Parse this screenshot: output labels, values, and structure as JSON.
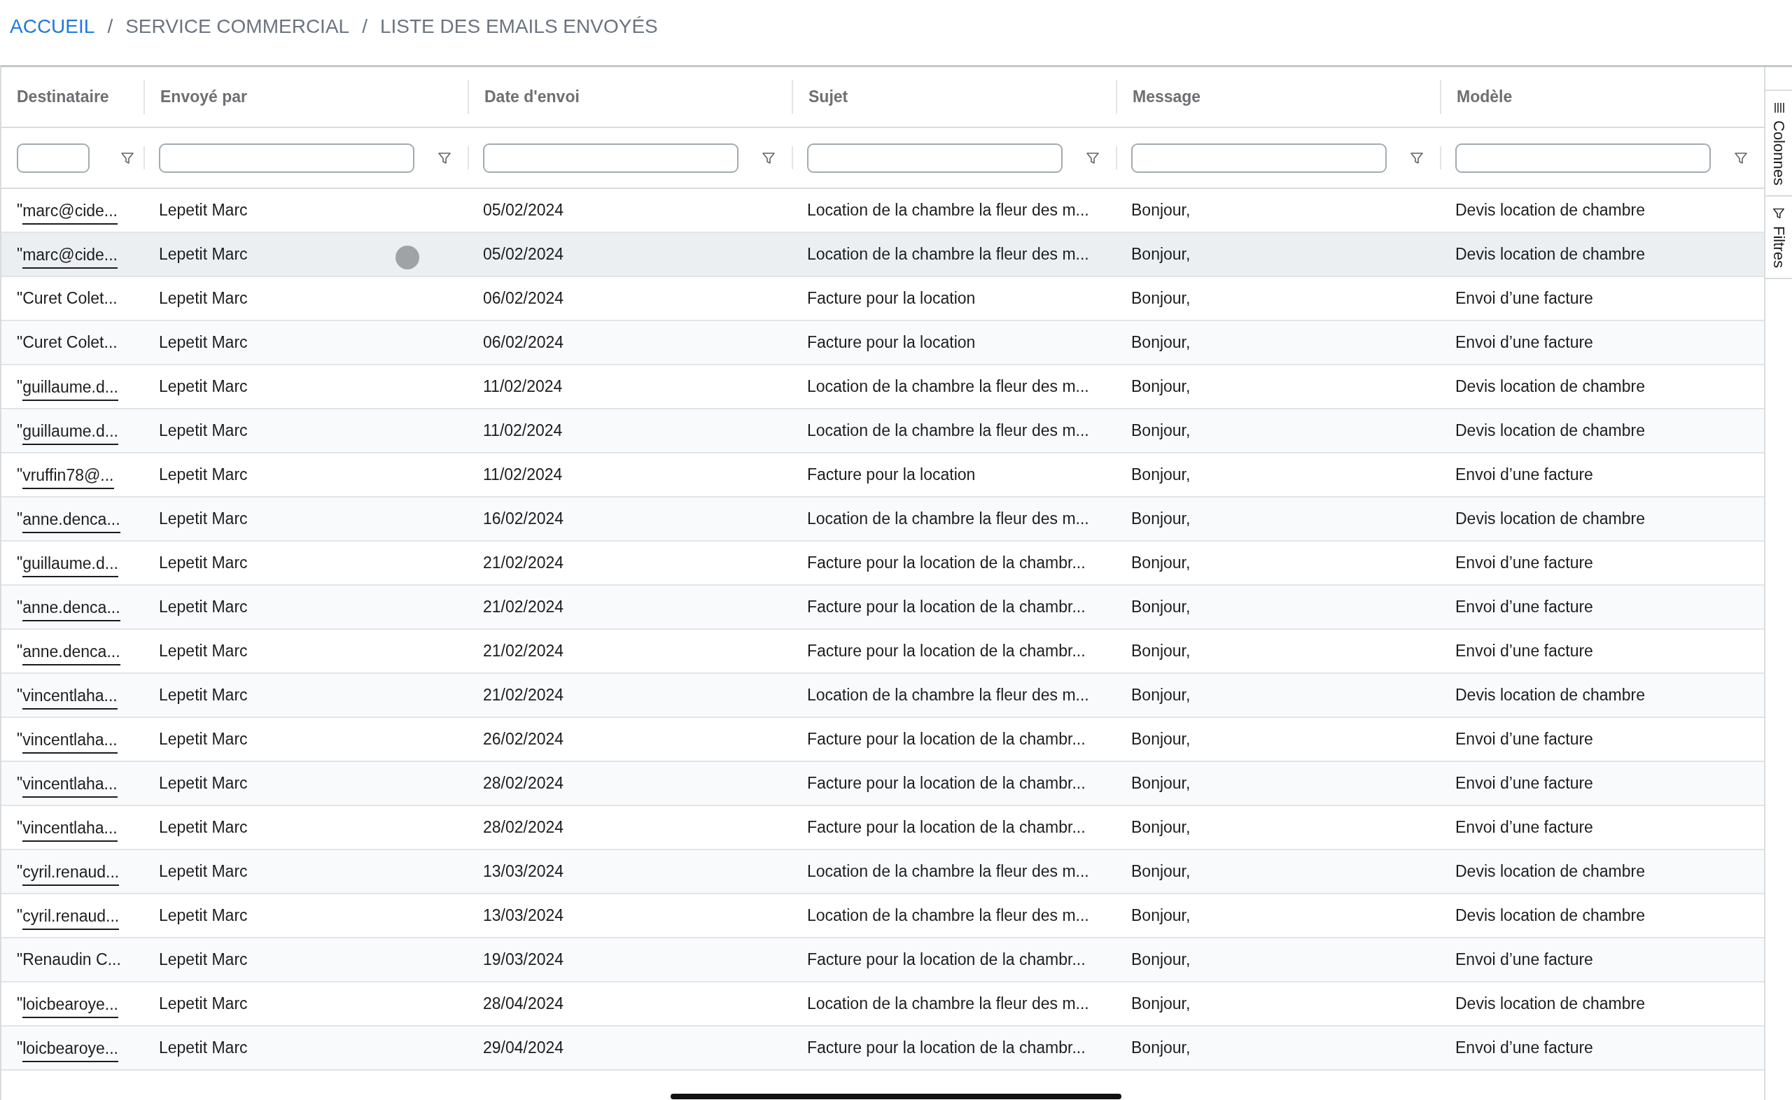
{
  "breadcrumb": [
    {
      "label": "ACCUEIL",
      "link": true
    },
    {
      "label": "SERVICE COMMERCIAL",
      "link": false
    },
    {
      "label": "LISTE DES EMAILS ENVOYÉS",
      "link": false
    }
  ],
  "breadcrumb_separator": "/",
  "table": {
    "columns": [
      "Destinataire",
      "Envoyé par",
      "Date d'envoi",
      "Sujet",
      "Message",
      "Modèle"
    ],
    "rows": [
      {
        "selected": false,
        "touch": false,
        "recipient": {
          "kind": "link",
          "prefix": "\"",
          "text": "marc@cide..."
        },
        "sender": "Lepetit Marc",
        "date": "05/02/2024",
        "subject": "Location de la chambre la fleur des m...",
        "message": "Bonjour,",
        "template": "Devis location de chambre"
      },
      {
        "selected": true,
        "touch": true,
        "recipient": {
          "kind": "link",
          "prefix": "\"",
          "text": "marc@cide..."
        },
        "sender": "Lepetit Marc",
        "date": "05/02/2024",
        "subject": "Location de la chambre la fleur des m...",
        "message": "Bonjour,",
        "template": "Devis location de chambre"
      },
      {
        "selected": false,
        "touch": false,
        "recipient": {
          "kind": "text",
          "text": "\"Curet Colet..."
        },
        "sender": "Lepetit Marc",
        "date": "06/02/2024",
        "subject": "Facture pour la location",
        "message": "Bonjour,",
        "template": "Envoi d’une facture"
      },
      {
        "selected": false,
        "touch": false,
        "recipient": {
          "kind": "text",
          "text": "\"Curet Colet..."
        },
        "sender": "Lepetit Marc",
        "date": "06/02/2024",
        "subject": "Facture pour la location",
        "message": "Bonjour,",
        "template": "Envoi d’une facture"
      },
      {
        "selected": false,
        "touch": false,
        "recipient": {
          "kind": "link",
          "prefix": "\"",
          "text": "guillaume.d..."
        },
        "sender": "Lepetit Marc",
        "date": "11/02/2024",
        "subject": "Location de la chambre la fleur des m...",
        "message": "Bonjour,",
        "template": "Devis location de chambre"
      },
      {
        "selected": false,
        "touch": false,
        "recipient": {
          "kind": "link",
          "prefix": "\"",
          "text": "guillaume.d..."
        },
        "sender": "Lepetit Marc",
        "date": "11/02/2024",
        "subject": "Location de la chambre la fleur des m...",
        "message": "Bonjour,",
        "template": "Devis location de chambre"
      },
      {
        "selected": false,
        "touch": false,
        "recipient": {
          "kind": "link",
          "prefix": "\"",
          "text": "vruffin78@..."
        },
        "sender": "Lepetit Marc",
        "date": "11/02/2024",
        "subject": "Facture pour la location",
        "message": "Bonjour,",
        "template": "Envoi d’une facture"
      },
      {
        "selected": false,
        "touch": false,
        "recipient": {
          "kind": "link",
          "prefix": "\"",
          "text": "anne.denca..."
        },
        "sender": "Lepetit Marc",
        "date": "16/02/2024",
        "subject": "Location de la chambre la fleur des m...",
        "message": "Bonjour,",
        "template": "Devis location de chambre"
      },
      {
        "selected": false,
        "touch": false,
        "recipient": {
          "kind": "link",
          "prefix": "\"",
          "text": "guillaume.d..."
        },
        "sender": "Lepetit Marc",
        "date": "21/02/2024",
        "subject": "Facture pour la location de la chambr...",
        "message": "Bonjour,",
        "template": "Envoi d’une facture"
      },
      {
        "selected": false,
        "touch": false,
        "recipient": {
          "kind": "link",
          "prefix": "\"",
          "text": "anne.denca..."
        },
        "sender": "Lepetit Marc",
        "date": "21/02/2024",
        "subject": "Facture pour la location de la chambr...",
        "message": "Bonjour,",
        "template": "Envoi d’une facture"
      },
      {
        "selected": false,
        "touch": false,
        "recipient": {
          "kind": "link",
          "prefix": "\"",
          "text": "anne.denca..."
        },
        "sender": "Lepetit Marc",
        "date": "21/02/2024",
        "subject": "Facture pour la location de la chambr...",
        "message": "Bonjour,",
        "template": "Envoi d’une facture"
      },
      {
        "selected": false,
        "touch": false,
        "recipient": {
          "kind": "link",
          "prefix": "\"",
          "text": "vincentlaha..."
        },
        "sender": "Lepetit Marc",
        "date": "21/02/2024",
        "subject": "Location de la chambre la fleur des m...",
        "message": "Bonjour,",
        "template": "Devis location de chambre"
      },
      {
        "selected": false,
        "touch": false,
        "recipient": {
          "kind": "link",
          "prefix": "\"",
          "text": "vincentlaha..."
        },
        "sender": "Lepetit Marc",
        "date": "26/02/2024",
        "subject": "Facture pour la location de la chambr...",
        "message": "Bonjour,",
        "template": "Envoi d’une facture"
      },
      {
        "selected": false,
        "touch": false,
        "recipient": {
          "kind": "link",
          "prefix": "\"",
          "text": "vincentlaha..."
        },
        "sender": "Lepetit Marc",
        "date": "28/02/2024",
        "subject": "Facture pour la location de la chambr...",
        "message": "Bonjour,",
        "template": "Envoi d’une facture"
      },
      {
        "selected": false,
        "touch": false,
        "recipient": {
          "kind": "link",
          "prefix": "\"",
          "text": "vincentlaha..."
        },
        "sender": "Lepetit Marc",
        "date": "28/02/2024",
        "subject": "Facture pour la location de la chambr...",
        "message": "Bonjour,",
        "template": "Envoi d’une facture"
      },
      {
        "selected": false,
        "touch": false,
        "recipient": {
          "kind": "link",
          "prefix": "\"",
          "text": "cyril.renaud..."
        },
        "sender": "Lepetit Marc",
        "date": "13/03/2024",
        "subject": "Location de la chambre la fleur des m...",
        "message": "Bonjour,",
        "template": "Devis location de chambre"
      },
      {
        "selected": false,
        "touch": false,
        "recipient": {
          "kind": "link",
          "prefix": "\"",
          "text": "cyril.renaud..."
        },
        "sender": "Lepetit Marc",
        "date": "13/03/2024",
        "subject": "Location de la chambre la fleur des m...",
        "message": "Bonjour,",
        "template": "Devis location de chambre"
      },
      {
        "selected": false,
        "touch": false,
        "recipient": {
          "kind": "text",
          "text": "\"Renaudin C..."
        },
        "sender": "Lepetit Marc",
        "date": "19/03/2024",
        "subject": "Facture pour la location de la chambr...",
        "message": "Bonjour,",
        "template": "Envoi d’une facture"
      },
      {
        "selected": false,
        "touch": false,
        "recipient": {
          "kind": "link",
          "prefix": "\"",
          "text": "loicbearoye..."
        },
        "sender": "Lepetit Marc",
        "date": "28/04/2024",
        "subject": "Location de la chambre la fleur des m...",
        "message": "Bonjour,",
        "template": "Devis location de chambre"
      },
      {
        "selected": false,
        "touch": false,
        "recipient": {
          "kind": "link",
          "prefix": "\"",
          "text": "loicbearoye..."
        },
        "sender": "Lepetit Marc",
        "date": "29/04/2024",
        "subject": "Facture pour la location de la chambr...",
        "message": "Bonjour,",
        "template": "Envoi d’une facture"
      }
    ]
  },
  "side_panel": [
    {
      "kind": "columns",
      "label": "Colonnes"
    },
    {
      "kind": "filters",
      "label": "Filtres"
    }
  ]
}
